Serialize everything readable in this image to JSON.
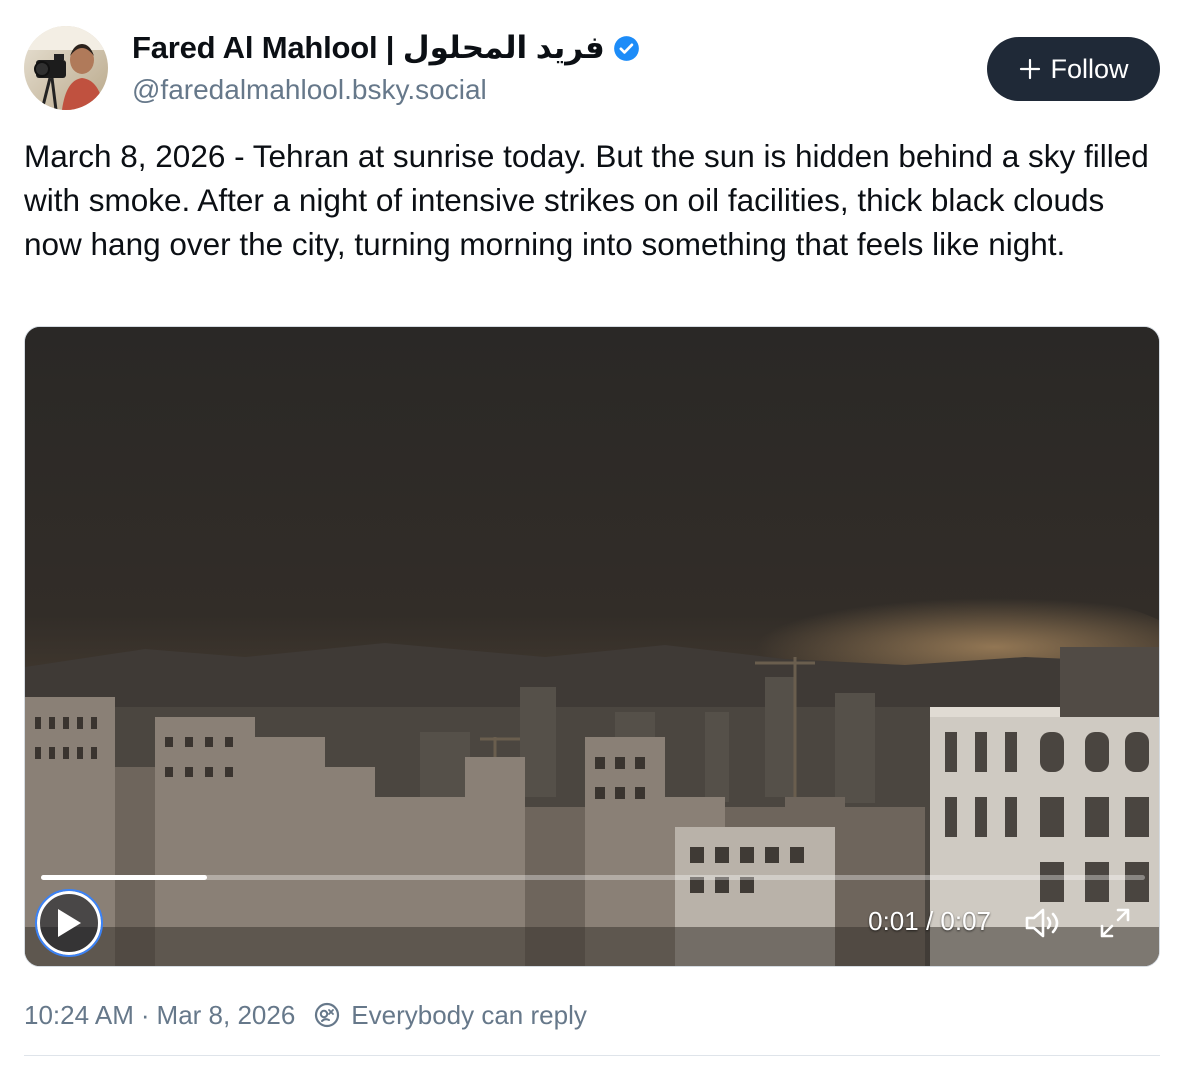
{
  "author": {
    "display_name": "Fared Al Mahlool | فريد المحلول",
    "handle": "@faredalmahlool.bsky.social",
    "verified_icon": "verified-check-icon",
    "avatar_icon": "avatar-photo"
  },
  "follow_button": {
    "label": "Follow",
    "icon": "plus-icon"
  },
  "post": {
    "text": "March 8, 2026 - Tehran at sunrise today. But the sun is hidden behind a sky filled with smoke. After a night of intensive strikes on oil facilities, thick black clouds now hang over the city, turning morning into something that feels like night."
  },
  "video": {
    "current_time": "0:01",
    "duration": "0:07",
    "time_display": "0:01 / 0:07",
    "progress_fraction": 0.15,
    "controls": {
      "play_icon": "play-icon",
      "mute_icon": "volume-icon",
      "fullscreen_icon": "fullscreen-icon"
    }
  },
  "meta": {
    "time": "10:24 AM",
    "separator": "·",
    "date": "Mar 8, 2026",
    "reply_setting": "Everybody can reply",
    "reply_icon": "reply-settings-icon"
  },
  "colors": {
    "follow_bg": "#1f2937",
    "verified_blue": "#1d8cf8",
    "muted_text": "#66788a",
    "text": "#0b0f14"
  }
}
